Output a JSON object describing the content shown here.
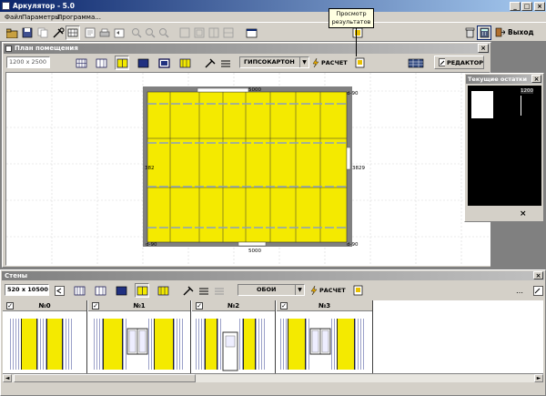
{
  "app": {
    "title": "Аркулятор - 5.0"
  },
  "menu": [
    "Файл",
    "Параметры",
    "Программа..."
  ],
  "toolbar": {
    "exit_label": "Выход"
  },
  "tooltip": {
    "text": "Просмотр результатов"
  },
  "room_window": {
    "title": "План помещения",
    "size_value": "1200 x 2500",
    "material": "ГИПСОКАРТОН",
    "calc_label": "РАСЧЕТ",
    "editor_label": "РЕДАКТОР",
    "dims": {
      "top": "5000",
      "bottom": "5000",
      "left": "382",
      "right": "3829",
      "corner_tr": "d-90",
      "corner_bl": "d-90",
      "corner_br": "d-90"
    }
  },
  "leftovers_window": {
    "title": "Текущие остатки",
    "label": "1200"
  },
  "walls_window": {
    "title": "Стены",
    "size_value": "520 x 10500",
    "material": "ОБОИ",
    "calc_label": "РАСЧЕТ",
    "walls": [
      {
        "name": "№0",
        "checked": "✓"
      },
      {
        "name": "№1",
        "checked": "✓"
      },
      {
        "name": "№2",
        "checked": "✓"
      },
      {
        "name": "№3",
        "checked": "✓"
      }
    ]
  },
  "colors": {
    "panel": "#f4ea00",
    "workspace": "#808080",
    "title_active": "#0a246a"
  }
}
